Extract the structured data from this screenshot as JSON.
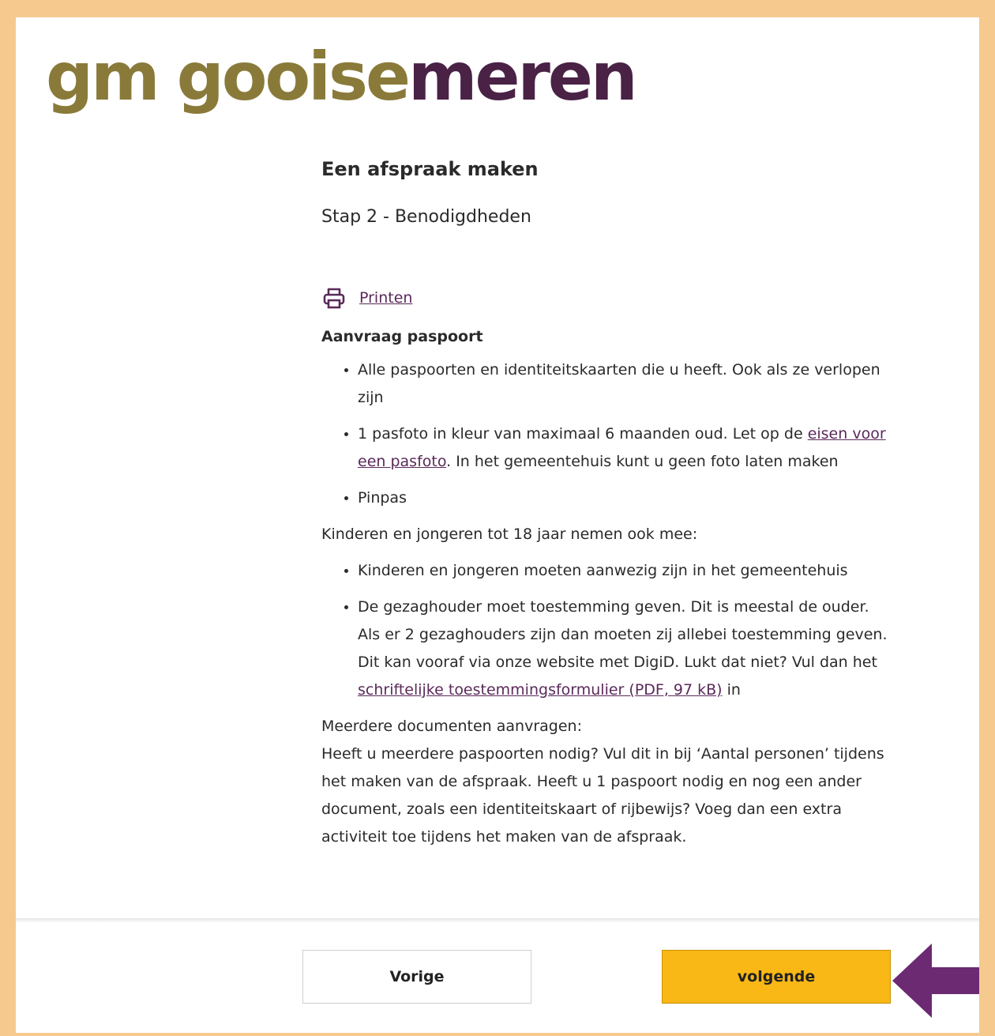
{
  "logo": {
    "text_gm": "gm",
    "text_gooise": "gooise",
    "text_meren": "meren"
  },
  "page": {
    "title": "Een afspraak maken",
    "step": "Stap 2 - Benodigdheden",
    "print_label": "Printen"
  },
  "passport": {
    "heading": "Aanvraag paspoort",
    "item1": "Alle paspoorten en identiteitskaarten die u heeft. Ook als ze verlopen zijn",
    "item2_pre": "1 pasfoto in kleur van maximaal 6 maanden oud. Let op de ",
    "item2_link": "eisen voor een pasfoto",
    "item2_post": ". In het gemeentehuis kunt u geen foto laten maken",
    "item3": "Pinpas"
  },
  "children": {
    "intro": "Kinderen en jongeren tot 18 jaar nemen ook mee:",
    "item1": "Kinderen en jongeren moeten aanwezig zijn in het gemeentehuis",
    "item2_pre": "De gezaghouder moet toestemming geven. Dit is meestal de ouder. Als er 2 gezaghouders zijn dan moeten zij allebei toestemming geven. Dit kan vooraf via onze website met DigiD. Lukt dat niet? Vul dan het ",
    "item2_link": "schriftelijke toestemmingsformulier (PDF, 97 kB)",
    "item2_post": " in"
  },
  "multiple": {
    "heading": "Meerdere documenten aanvragen:",
    "text": "Heeft u meerdere paspoorten nodig? Vul dit in bij ‘Aantal personen’ tijdens het maken van de afspraak. Heeft u 1 paspoort nodig en nog een ander document, zoals een identiteitskaart of rijbewijs? Voeg dan een extra activiteit toe tijdens het maken van de afspraak."
  },
  "buttons": {
    "prev": "Vorige",
    "next": "volgende"
  },
  "colors": {
    "border": "#f6c98f",
    "logo_olive": "#8a7a3a",
    "logo_purple": "#4a2246",
    "next_button": "#f9b815",
    "arrow": "#6b2a72",
    "link": "#5a2a5a"
  },
  "icons": {
    "print": "printer-icon",
    "annotation": "arrow-left-icon"
  }
}
